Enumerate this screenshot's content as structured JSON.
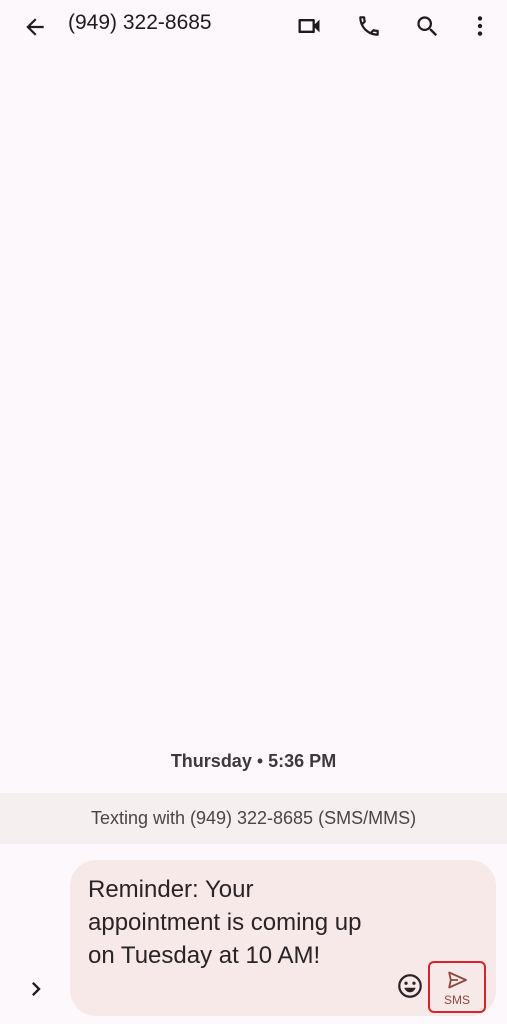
{
  "header": {
    "title": "(949) 322-8685",
    "back_icon": "arrow-back-icon",
    "video_icon": "video-call-icon",
    "call_icon": "phone-icon",
    "search_icon": "search-icon",
    "more_icon": "more-vert-icon"
  },
  "conversation": {
    "timestamp_day": "Thursday",
    "timestamp_sep": " • ",
    "timestamp_time": "5:36 PM",
    "texting_banner": "Texting with (949) 322-8685 (SMS/MMS)"
  },
  "compose": {
    "draft_text": "Reminder: Your appointment is coming up on Tuesday at 10 AM!",
    "send_label": "SMS",
    "expand_icon": "chevron-right-icon",
    "emoji_icon": "emoji-icon",
    "send_icon": "send-icon"
  },
  "colors": {
    "background": "#fdf8fc",
    "compose_bg": "#f6e9e8",
    "banner_bg": "#f5efef",
    "highlight_border": "#d8232a",
    "send_accent": "#8b4a3d"
  }
}
